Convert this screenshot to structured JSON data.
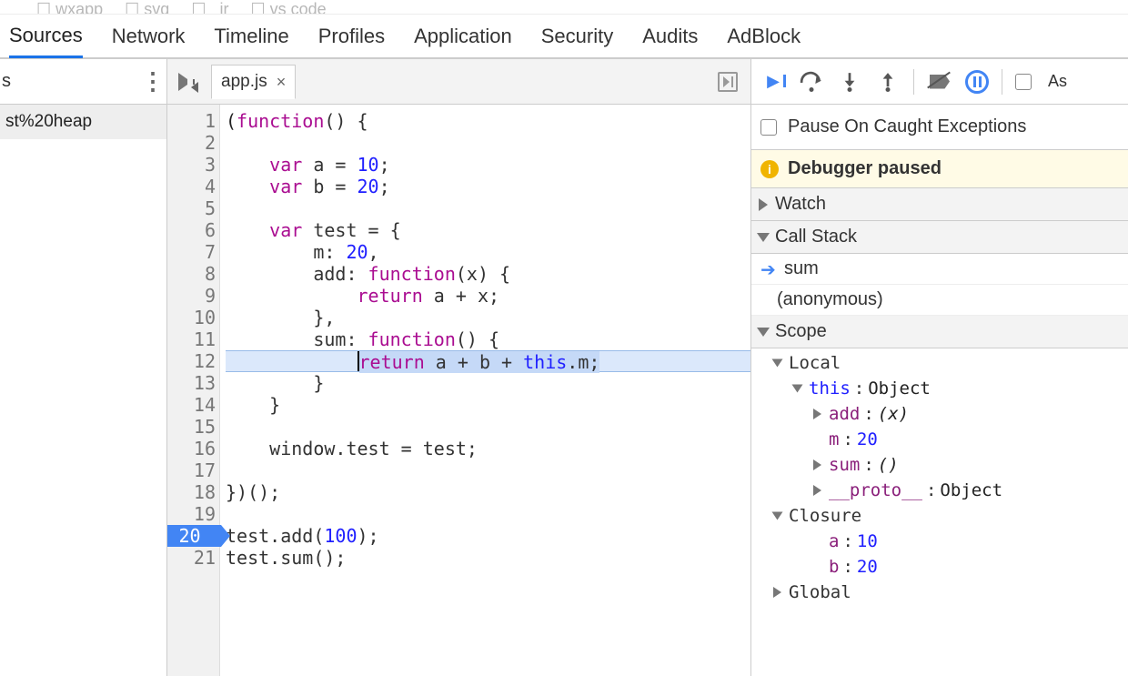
{
  "top_folders": [
    "wxapp",
    "svg",
    "_jr",
    "vs code"
  ],
  "tabs": [
    "Sources",
    "Network",
    "Timeline",
    "Profiles",
    "Application",
    "Security",
    "Audits",
    "AdBlock"
  ],
  "active_tab": "Sources",
  "nav": {
    "title_cut": "s",
    "tree_item": "st%20heap"
  },
  "editor": {
    "file_tab": "app.js",
    "close_x": "×"
  },
  "code_lines": [
    {
      "n": 1,
      "html": "<span class='paren'>(</span><span class='kw'>function</span>() {"
    },
    {
      "n": 2,
      "html": ""
    },
    {
      "n": 3,
      "html": "    <span class='kw'>var</span> a = <span class='num'>10</span>;"
    },
    {
      "n": 4,
      "html": "    <span class='kw'>var</span> b = <span class='num'>20</span>;"
    },
    {
      "n": 5,
      "html": ""
    },
    {
      "n": 6,
      "html": "    <span class='kw'>var</span> test = {"
    },
    {
      "n": 7,
      "html": "        m: <span class='num'>20</span>,"
    },
    {
      "n": 8,
      "html": "        add: <span class='kw'>function</span>(x) {"
    },
    {
      "n": 9,
      "html": "            <span class='kw'>return</span> a + x;"
    },
    {
      "n": 10,
      "html": "        },"
    },
    {
      "n": 11,
      "html": "        sum: <span class='kw'>function</span>() {"
    },
    {
      "n": 12,
      "exec": true,
      "html": "<span class='exec-cursor'></span><span class='exec-hl'><span class='kw'>return</span> a + b + <span class='this'>this</span>.m;</span>",
      "prefix": "            "
    },
    {
      "n": 13,
      "html": "        }"
    },
    {
      "n": 14,
      "html": "    }"
    },
    {
      "n": 15,
      "html": ""
    },
    {
      "n": 16,
      "html": "    window.test = test;"
    },
    {
      "n": 17,
      "html": ""
    },
    {
      "n": 18,
      "html": "})();"
    },
    {
      "n": 19,
      "html": ""
    },
    {
      "n": 20,
      "bp": true,
      "html": "test.add(<span class='num'>100</span>);"
    },
    {
      "n": 21,
      "html": "test.sum();"
    }
  ],
  "debugger": {
    "pause_caught_label": "Pause On Caught Exceptions",
    "status": "Debugger paused",
    "right_cut": "As",
    "sections": {
      "watch": "Watch",
      "callstack": "Call Stack",
      "scope": "Scope"
    },
    "callstack": [
      {
        "label": "sum",
        "current": true
      },
      {
        "label": "(anonymous)",
        "current": false
      }
    ],
    "scope": {
      "local_label": "Local",
      "this_label": "this",
      "this_type": "Object",
      "this_props": [
        {
          "k": "add",
          "v": "(x)",
          "kind": "fn",
          "exp": false
        },
        {
          "k": "m",
          "v": "20",
          "kind": "num",
          "exp": null
        },
        {
          "k": "sum",
          "v": "()",
          "kind": "fn",
          "exp": false
        },
        {
          "k": "__proto__",
          "v": "Object",
          "kind": "obj",
          "exp": false
        }
      ],
      "closure_label": "Closure",
      "closure_props": [
        {
          "k": "a",
          "v": "10",
          "kind": "num"
        },
        {
          "k": "b",
          "v": "20",
          "kind": "num"
        }
      ],
      "global_label": "Global"
    }
  }
}
